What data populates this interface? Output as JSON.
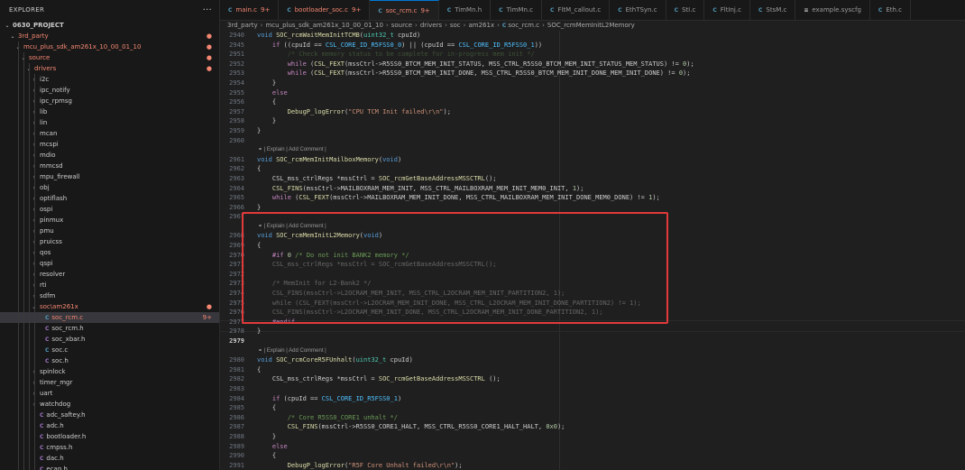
{
  "sidebar": {
    "title": "EXPLORER",
    "more": "···",
    "rows": [
      {
        "label": "0630_PROJECT",
        "depth": 0,
        "chev": "v",
        "kind": "root",
        "red": false,
        "mark": ""
      },
      {
        "label": "3rd_party",
        "depth": 1,
        "chev": "v",
        "kind": "folder",
        "red": true,
        "mark": "●"
      },
      {
        "label": "mcu_plus_sdk_am261x_10_00_01_10",
        "depth": 2,
        "chev": "v",
        "kind": "folder",
        "red": true,
        "mark": "●"
      },
      {
        "label": "source",
        "depth": 3,
        "chev": "v",
        "kind": "folder",
        "red": true,
        "mark": "●"
      },
      {
        "label": "drivers",
        "depth": 4,
        "chev": "v",
        "kind": "folder",
        "red": true,
        "mark": "●"
      },
      {
        "label": "i2c",
        "depth": 5,
        "chev": ">",
        "kind": "folder",
        "red": false,
        "mark": ""
      },
      {
        "label": "ipc_notify",
        "depth": 5,
        "chev": ">",
        "kind": "folder",
        "red": false,
        "mark": ""
      },
      {
        "label": "ipc_rpmsg",
        "depth": 5,
        "chev": ">",
        "kind": "folder",
        "red": false,
        "mark": ""
      },
      {
        "label": "lib",
        "depth": 5,
        "chev": ">",
        "kind": "folder",
        "red": false,
        "mark": ""
      },
      {
        "label": "lin",
        "depth": 5,
        "chev": ">",
        "kind": "folder",
        "red": false,
        "mark": ""
      },
      {
        "label": "mcan",
        "depth": 5,
        "chev": ">",
        "kind": "folder",
        "red": false,
        "mark": ""
      },
      {
        "label": "mcspi",
        "depth": 5,
        "chev": ">",
        "kind": "folder",
        "red": false,
        "mark": ""
      },
      {
        "label": "mdio",
        "depth": 5,
        "chev": ">",
        "kind": "folder",
        "red": false,
        "mark": ""
      },
      {
        "label": "mmcsd",
        "depth": 5,
        "chev": ">",
        "kind": "folder",
        "red": false,
        "mark": ""
      },
      {
        "label": "mpu_firewall",
        "depth": 5,
        "chev": ">",
        "kind": "folder",
        "red": false,
        "mark": ""
      },
      {
        "label": "obj",
        "depth": 5,
        "chev": ">",
        "kind": "folder",
        "red": false,
        "mark": ""
      },
      {
        "label": "optiflash",
        "depth": 5,
        "chev": ">",
        "kind": "folder",
        "red": false,
        "mark": ""
      },
      {
        "label": "ospi",
        "depth": 5,
        "chev": ">",
        "kind": "folder",
        "red": false,
        "mark": ""
      },
      {
        "label": "pinmux",
        "depth": 5,
        "chev": ">",
        "kind": "folder",
        "red": false,
        "mark": ""
      },
      {
        "label": "pmu",
        "depth": 5,
        "chev": ">",
        "kind": "folder",
        "red": false,
        "mark": ""
      },
      {
        "label": "pruicss",
        "depth": 5,
        "chev": ">",
        "kind": "folder",
        "red": false,
        "mark": ""
      },
      {
        "label": "qos",
        "depth": 5,
        "chev": ">",
        "kind": "folder",
        "red": false,
        "mark": ""
      },
      {
        "label": "qspi",
        "depth": 5,
        "chev": ">",
        "kind": "folder",
        "red": false,
        "mark": ""
      },
      {
        "label": "resolver",
        "depth": 5,
        "chev": ">",
        "kind": "folder",
        "red": false,
        "mark": ""
      },
      {
        "label": "rti",
        "depth": 5,
        "chev": ">",
        "kind": "folder",
        "red": false,
        "mark": ""
      },
      {
        "label": "sdfm",
        "depth": 5,
        "chev": ">",
        "kind": "folder",
        "red": false,
        "mark": ""
      },
      {
        "label": "soc\\am261x",
        "depth": 5,
        "chev": "v",
        "kind": "folder",
        "red": true,
        "mark": "●"
      },
      {
        "label": "soc_rcm.c",
        "depth": 6,
        "chev": "",
        "kind": "c",
        "red": true,
        "mark": "9+",
        "selected": true
      },
      {
        "label": "soc_rcm.h",
        "depth": 6,
        "chev": "",
        "kind": "c",
        "red": false,
        "mark": ""
      },
      {
        "label": "soc_xbar.h",
        "depth": 6,
        "chev": "",
        "kind": "c",
        "red": false,
        "mark": ""
      },
      {
        "label": "soc.c",
        "depth": 6,
        "chev": "",
        "kind": "c",
        "red": false,
        "mark": ""
      },
      {
        "label": "soc.h",
        "depth": 6,
        "chev": "",
        "kind": "c",
        "red": false,
        "mark": ""
      },
      {
        "label": "spinlock",
        "depth": 5,
        "chev": ">",
        "kind": "folder",
        "red": false,
        "mark": ""
      },
      {
        "label": "timer_mgr",
        "depth": 5,
        "chev": ">",
        "kind": "folder",
        "red": false,
        "mark": ""
      },
      {
        "label": "uart",
        "depth": 5,
        "chev": ">",
        "kind": "folder",
        "red": false,
        "mark": ""
      },
      {
        "label": "watchdog",
        "depth": 5,
        "chev": ">",
        "kind": "folder",
        "red": false,
        "mark": ""
      },
      {
        "label": "adc_saftey.h",
        "depth": 5,
        "chev": "",
        "kind": "c",
        "red": false,
        "mark": ""
      },
      {
        "label": "adc.h",
        "depth": 5,
        "chev": "",
        "kind": "c",
        "red": false,
        "mark": ""
      },
      {
        "label": "bootloader.h",
        "depth": 5,
        "chev": "",
        "kind": "c",
        "red": false,
        "mark": ""
      },
      {
        "label": "cmpss.h",
        "depth": 5,
        "chev": "",
        "kind": "c",
        "red": false,
        "mark": ""
      },
      {
        "label": "dac.h",
        "depth": 5,
        "chev": "",
        "kind": "c",
        "red": false,
        "mark": ""
      },
      {
        "label": "ecap.h",
        "depth": 5,
        "chev": "",
        "kind": "c",
        "red": false,
        "mark": ""
      }
    ]
  },
  "tabs": [
    {
      "label": "main.c",
      "badge": "9+",
      "modified": true,
      "active": false,
      "icon": "C"
    },
    {
      "label": "bootloader_soc.c",
      "badge": "9+",
      "modified": true,
      "active": false,
      "icon": "C"
    },
    {
      "label": "soc_rcm.c",
      "badge": "9+",
      "modified": true,
      "active": true,
      "icon": "C"
    },
    {
      "label": "TimMn.h",
      "badge": "",
      "modified": false,
      "active": false,
      "icon": "C"
    },
    {
      "label": "TimMn.c",
      "badge": "",
      "modified": false,
      "active": false,
      "icon": "C"
    },
    {
      "label": "FltM_callout.c",
      "badge": "",
      "modified": false,
      "active": false,
      "icon": "C"
    },
    {
      "label": "EthTSyn.c",
      "badge": "",
      "modified": false,
      "active": false,
      "icon": "C"
    },
    {
      "label": "StI.c",
      "badge": "",
      "modified": false,
      "active": false,
      "icon": "C"
    },
    {
      "label": "FltInj.c",
      "badge": "",
      "modified": false,
      "active": false,
      "icon": "C"
    },
    {
      "label": "StsM.c",
      "badge": "",
      "modified": false,
      "active": false,
      "icon": "C"
    },
    {
      "label": "example.syscfg",
      "badge": "",
      "modified": false,
      "active": false,
      "icon": "≡"
    },
    {
      "label": "Eth.c",
      "badge": "",
      "modified": false,
      "active": false,
      "icon": "C"
    }
  ],
  "breadcrumb": [
    "3rd_party",
    "mcu_plus_sdk_am261x_10_00_01_10",
    "source",
    "drivers",
    "soc",
    "am261x",
    "soc_rcm.c",
    "SOC_rcmMemInitL2Memory"
  ],
  "lens_text": "| Explain | Add Comment |",
  "editor": [
    {
      "ln": "2940",
      "code": "<span class=\"kw\">void</span> <span class=\"fn\">SOC_rcmWaitMemInitTCMB</span>(<span class=\"ty\">uint32_t</span> cpuId)"
    },
    {
      "ln": "2945",
      "code": "    <span class=\"ctl\">if</span> ((cpuId == <span class=\"mac\">CSL_CORE_ID_R5FSS0_0</span>) || (cpuId == <span class=\"mac\">CSL_CORE_ID_R5FSS0_1</span>))"
    },
    {
      "ln": "2951",
      "code": "        <span class=\"cm\">/* Check memory status to be complete for in-progress mem init */</span>",
      "dim": true
    },
    {
      "ln": "2952",
      "code": "        <span class=\"ctl\">while</span> (<span class=\"fn\">CSL_FEXT</span>(mssCtrl-&gt;R5SS0_BTCM_MEM_INIT_STATUS, MSS_CTRL_R5SS0_BTCM_MEM_INIT_STATUS_MEM_STATUS) != <span class=\"num\">0</span>);"
    },
    {
      "ln": "2953",
      "code": "        <span class=\"ctl\">while</span> (<span class=\"fn\">CSL_FEXT</span>(mssCtrl-&gt;R5SS0_BTCM_MEM_INIT_DONE, MSS_CTRL_R5SS0_BTCM_MEM_INIT_DONE_MEM_INIT_DONE) != <span class=\"num\">0</span>);"
    },
    {
      "ln": "2954",
      "code": "    }"
    },
    {
      "ln": "2955",
      "code": "    <span class=\"ctl\">else</span>"
    },
    {
      "ln": "2956",
      "code": "    {"
    },
    {
      "ln": "2957",
      "code": "        <span class=\"fn\">DebugP_logError</span>(<span class=\"str\">\"CPU TCM Init failed\\r\\n\"</span>);"
    },
    {
      "ln": "2958",
      "code": "    }"
    },
    {
      "ln": "2959",
      "code": "}"
    },
    {
      "ln": "2960",
      "code": ""
    },
    {
      "lens": true
    },
    {
      "ln": "2961",
      "code": "<span class=\"kw\">void</span> <span class=\"fn\">SOC_rcmMemInitMailboxMemory</span>(<span class=\"kw\">void</span>)"
    },
    {
      "ln": "2962",
      "code": "{"
    },
    {
      "ln": "2963",
      "code": "    CSL_mss_ctrlRegs *mssCtrl = <span class=\"fn\">SOC_rcmGetBaseAddressMSSCTRL</span>();"
    },
    {
      "ln": "2964",
      "code": "    <span class=\"fn\">CSL_FINS</span>(mssCtrl-&gt;MAILBOXRAM_MEM_INIT, MSS_CTRL_MAILBOXRAM_MEM_INIT_MEM0_INIT, <span class=\"num\">1</span>);"
    },
    {
      "ln": "2965",
      "code": "    <span class=\"ctl\">while</span> (<span class=\"fn\">CSL_FEXT</span>(mssCtrl-&gt;MAILBOXRAM_MEM_INIT_DONE, MSS_CTRL_MAILBOXRAM_MEM_INIT_DONE_MEM0_DONE) != <span class=\"num\">1</span>);"
    },
    {
      "ln": "2966",
      "code": "}"
    },
    {
      "ln": "2967",
      "code": ""
    },
    {
      "lens": true
    },
    {
      "ln": "2968",
      "code": "<span class=\"kw\">void</span> <span class=\"fn\">SOC_rcmMemInitL2Memory</span>(<span class=\"kw\">void</span>)"
    },
    {
      "ln": "2969",
      "code": "{"
    },
    {
      "ln": "2970",
      "code": "    <span class=\"pp\">#if</span> <span class=\"num\">0</span> <span class=\"cm\">/* Do not init BANK2 memory */</span>"
    },
    {
      "ln": "2971",
      "code": "    CSL_mss_ctrlRegs *mssCtrl = SOC_rcmGetBaseAddressMSSCTRL();",
      "dim": true
    },
    {
      "ln": "2972",
      "code": ""
    },
    {
      "ln": "2973",
      "code": "    /* MemInit for L2-Bank2 */",
      "dim": true
    },
    {
      "ln": "2974",
      "code": "    CSL_FINS(mssCtrl-&gt;L2OCRAM_MEM_INIT, MSS_CTRL_L2OCRAM_MEM_INIT_PARTITION2, 1);",
      "dim": true
    },
    {
      "ln": "2975",
      "code": "    while (CSL_FEXT(mssCtrl-&gt;L2OCRAM_MEM_INIT_DONE, MSS_CTRL_L2OCRAM_MEM_INIT_DONE_PARTITION2) != 1);",
      "dim": true
    },
    {
      "ln": "2976",
      "code": "    CSL_FINS(mssCtrl-&gt;L2OCRAM_MEM_INIT_DONE, MSS_CTRL_L2OCRAM_MEM_INIT_DONE_PARTITION2, 1);",
      "dim": true
    },
    {
      "ln": "2977",
      "code": "    <span class=\"pp\">#endif</span>"
    },
    {
      "ln": "2978",
      "code": "}"
    },
    {
      "ln": "2979",
      "code": "",
      "cur": true
    },
    {
      "lens": true
    },
    {
      "ln": "2980",
      "code": "<span class=\"kw\">void</span> <span class=\"fn\">SOC_rcmCoreR5FUnhalt</span>(<span class=\"ty\">uint32_t</span> cpuId)"
    },
    {
      "ln": "2981",
      "code": "{"
    },
    {
      "ln": "2982",
      "code": "    CSL_mss_ctrlRegs *mssCtrl = <span class=\"fn\">SOC_rcmGetBaseAddressMSSCTRL</span> ();"
    },
    {
      "ln": "2983",
      "code": ""
    },
    {
      "ln": "2984",
      "code": "    <span class=\"ctl\">if</span> (cpuId == <span class=\"mac\">CSL_CORE_ID_R5FSS0_1</span>)"
    },
    {
      "ln": "2985",
      "code": "    {"
    },
    {
      "ln": "2986",
      "code": "        <span class=\"cm\">/* Core R5SS0_CORE1 unhalt */</span>"
    },
    {
      "ln": "2987",
      "code": "        <span class=\"fn\">CSL_FINS</span>(mssCtrl-&gt;R5SS0_CORE1_HALT, MSS_CTRL_R5SS0_CORE1_HALT_HALT, <span class=\"num\">0x0</span>);"
    },
    {
      "ln": "2988",
      "code": "    }"
    },
    {
      "ln": "2989",
      "code": "    <span class=\"ctl\">else</span>"
    },
    {
      "ln": "2990",
      "code": "    {"
    },
    {
      "ln": "2991",
      "code": "        <span class=\"fn\">DebugP_logError</span>(<span class=\"str\">\"R5F Core Unhalt failed\\r\\n\"</span>);"
    },
    {
      "ln": "2992",
      "code": "    }"
    },
    {
      "ln": "2993",
      "code": "}"
    }
  ]
}
